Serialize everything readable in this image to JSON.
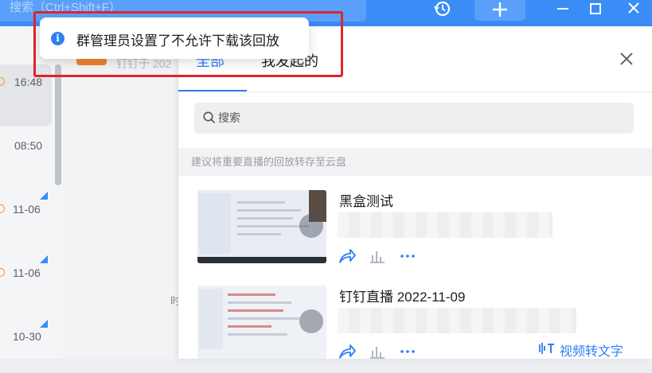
{
  "titlebar": {
    "search_placeholder": "搜索（Ctrl+Shift+F）",
    "icons": [
      "history-icon",
      "plus-icon",
      "minimize-icon",
      "maximize-icon",
      "close-icon"
    ]
  },
  "chat_list": {
    "times": [
      "16:48",
      "08:50",
      "11-06",
      "11-06",
      "10-30"
    ]
  },
  "middle": {
    "faint_text": "钉钉于 202",
    "partial_char": "时"
  },
  "panel": {
    "tabs": [
      {
        "label": "全部",
        "active": true
      },
      {
        "label": "我发起的",
        "active": false
      }
    ],
    "search_placeholder": "搜索",
    "tip": "建议将重要直播的回放转存至云盘",
    "records": [
      {
        "title": "黑盒测试"
      },
      {
        "title": "钉钉直播 2022-11-09"
      }
    ],
    "video_to_text": "视频转文字"
  },
  "toast": {
    "message": "群管理员设置了不允许下载该回放",
    "icon": "info-icon"
  },
  "colors": {
    "brand": "#3a8cf7",
    "accent": "#2f7ef5",
    "highlight": "#e0242a"
  }
}
